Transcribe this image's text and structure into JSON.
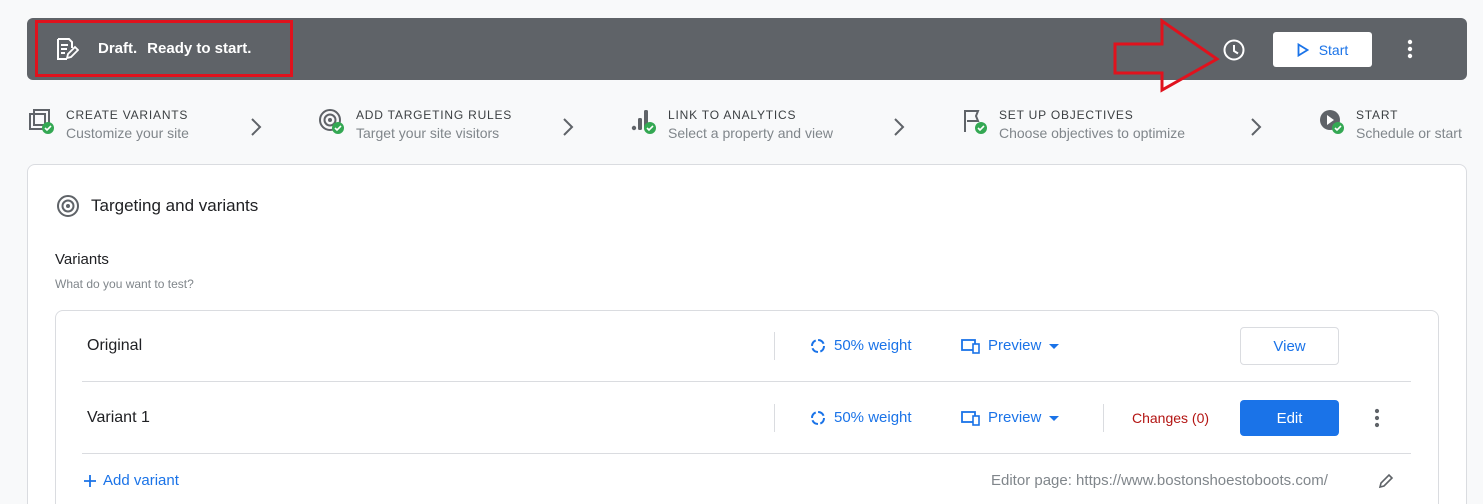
{
  "status": {
    "draft_label": "Draft.",
    "state_label": "Ready to start."
  },
  "toolbar": {
    "start_label": "Start"
  },
  "steps": [
    {
      "title": "CREATE VARIANTS",
      "sub": "Customize your site",
      "icon": "variants-icon"
    },
    {
      "title": "ADD TARGETING RULES",
      "sub": "Target your site visitors",
      "icon": "targeting-icon"
    },
    {
      "title": "LINK TO ANALYTICS",
      "sub": "Select a property and view",
      "icon": "analytics-icon"
    },
    {
      "title": "SET UP OBJECTIVES",
      "sub": "Choose objectives to optimize",
      "icon": "objectives-icon"
    },
    {
      "title": "START",
      "sub": "Schedule or start",
      "icon": "start-icon"
    }
  ],
  "card": {
    "title": "Targeting and variants",
    "variants_label": "Variants",
    "variants_sub": "What do you want to test?"
  },
  "rows": [
    {
      "name": "Original",
      "weight": "50% weight",
      "preview": "Preview",
      "action": "View"
    },
    {
      "name": "Variant 1",
      "weight": "50% weight",
      "preview": "Preview",
      "changes": "Changes (0)",
      "action": "Edit"
    }
  ],
  "footer": {
    "add_variant": "Add variant",
    "editor_page": "Editor page: https://www.bostonshoestoboots.com/"
  },
  "colors": {
    "accent": "#1a73e8",
    "topbar": "#5f6368",
    "annotation": "#e0121d",
    "success": "#34a853",
    "changes": "#b31412"
  }
}
